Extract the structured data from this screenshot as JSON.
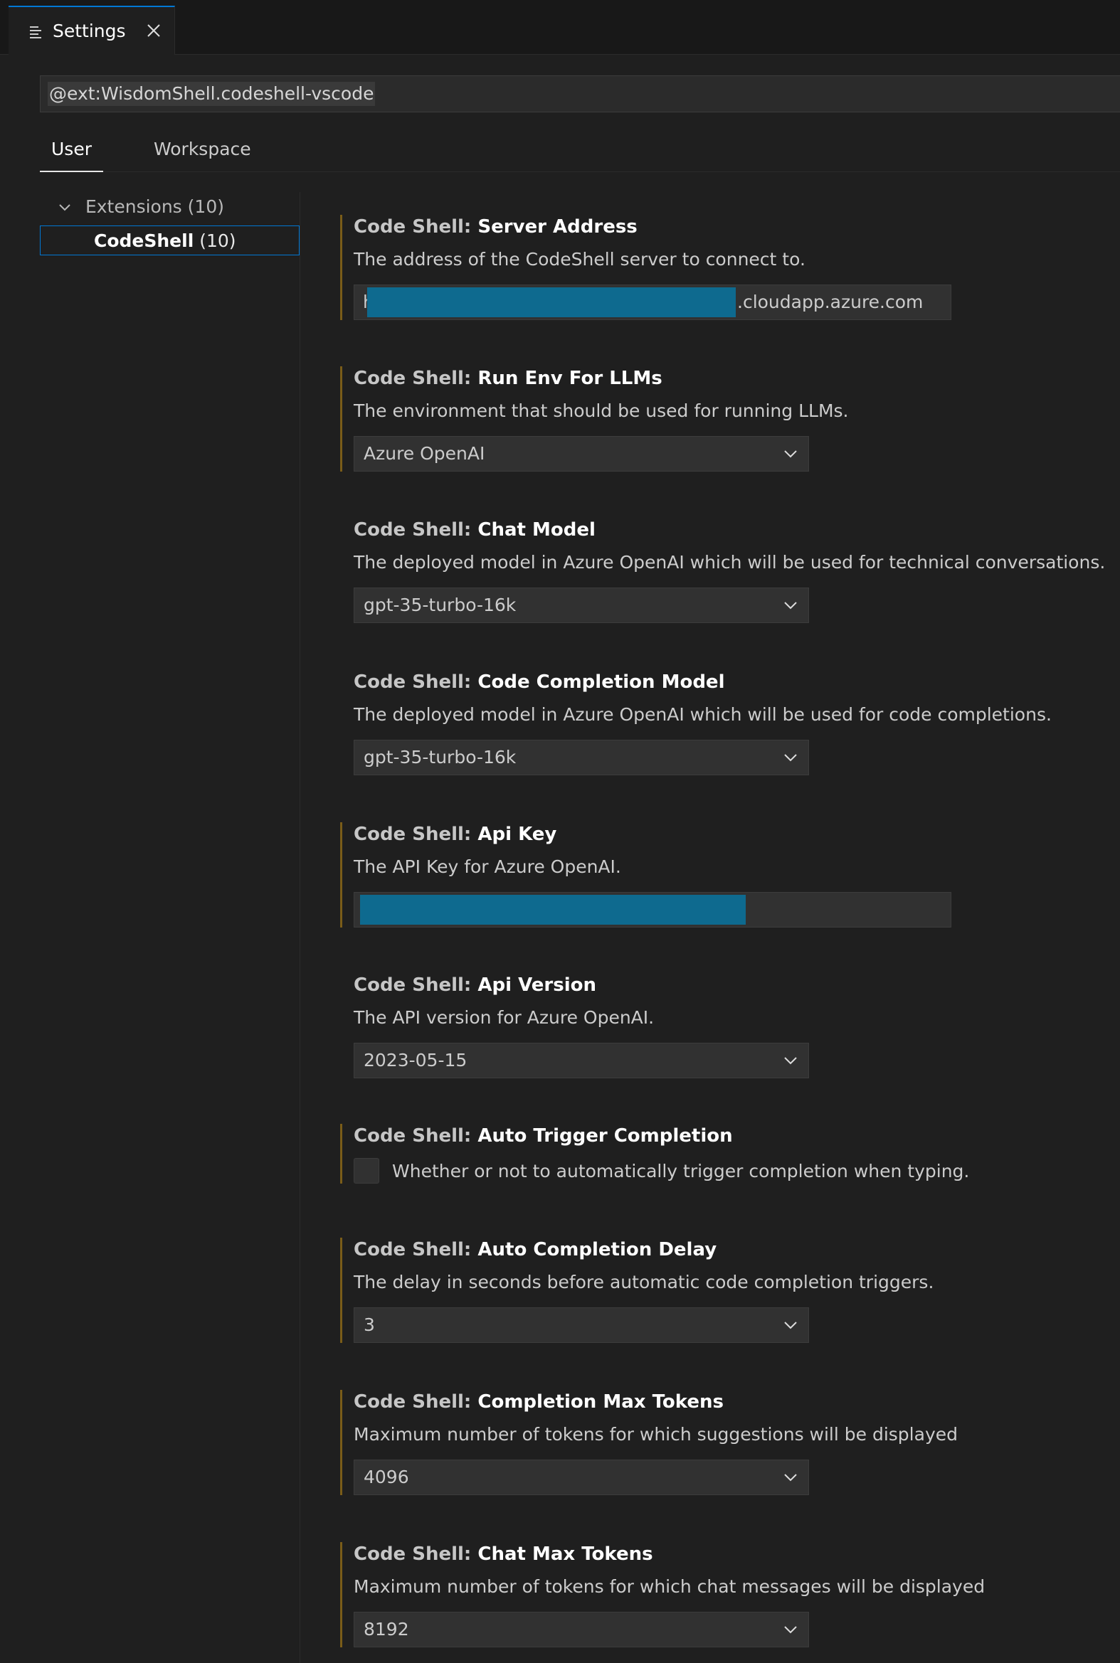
{
  "editor": {
    "tab_label": "Settings"
  },
  "search": {
    "value": "@ext:WisdomShell.codeshell-vscode"
  },
  "scope_tabs": {
    "user": "User",
    "workspace": "Workspace"
  },
  "toc": {
    "extensions": "Extensions (10)",
    "codeshell_name": "CodeShell",
    "codeshell_count": "(10)"
  },
  "settings": [
    {
      "category": "Code Shell: ",
      "name": "Server Address",
      "description": "The address of the CodeShell server to connect to.",
      "control": "text",
      "value_prefix": "h",
      "value_suffix": ".cloudapp.azure.com"
    },
    {
      "category": "Code Shell: ",
      "name": "Run Env For LLMs",
      "description": "The environment that should be used for running LLMs.",
      "control": "select",
      "value": "Azure OpenAI"
    },
    {
      "category": "Code Shell: ",
      "name": "Chat Model",
      "description": "The deployed model in Azure OpenAI which will be used for technical conversations.",
      "control": "select",
      "value": "gpt-35-turbo-16k"
    },
    {
      "category": "Code Shell: ",
      "name": "Code Completion Model",
      "description": "The deployed model in Azure OpenAI which will be used for code completions.",
      "control": "select",
      "value": "gpt-35-turbo-16k"
    },
    {
      "category": "Code Shell: ",
      "name": "Api Key",
      "description": "The API Key for Azure OpenAI.",
      "control": "text"
    },
    {
      "category": "Code Shell: ",
      "name": "Api Version",
      "description": "The API version for Azure OpenAI.",
      "control": "select",
      "value": "2023-05-15"
    },
    {
      "category": "Code Shell: ",
      "name": "Auto Trigger Completion",
      "description": "Whether or not to automatically trigger completion when typing.",
      "control": "checkbox"
    },
    {
      "category": "Code Shell: ",
      "name": "Auto Completion Delay",
      "description": "The delay in seconds before automatic code completion triggers.",
      "control": "select",
      "value": "3"
    },
    {
      "category": "Code Shell: ",
      "name": "Completion Max Tokens",
      "description": "Maximum number of tokens for which suggestions will be displayed",
      "control": "select",
      "value": "4096"
    },
    {
      "category": "Code Shell: ",
      "name": "Chat Max Tokens",
      "description": "Maximum number of tokens for which chat messages will be displayed",
      "control": "select",
      "value": "8192"
    }
  ],
  "colors": {
    "accent": "#0078d4",
    "modified_indicator": "#7a5c18",
    "redaction": "#0e6a8f"
  }
}
